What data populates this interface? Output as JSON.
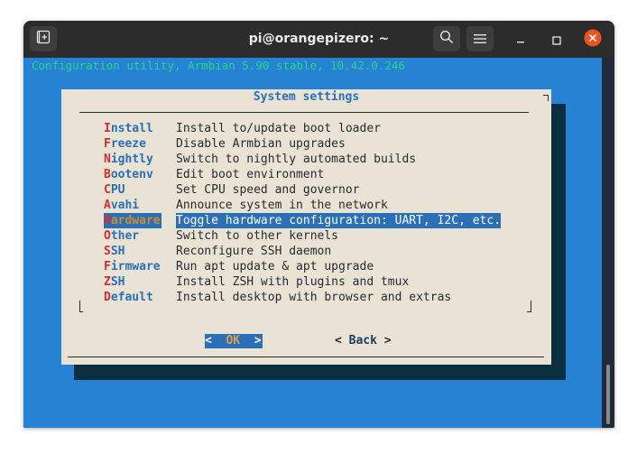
{
  "window": {
    "title": "pi@orangepizero: ~"
  },
  "terminal": {
    "backtitle": "Configuration utility, Armbian 5.90 stable, 10.42.0.246",
    "dialog": {
      "title": "System settings",
      "items": [
        {
          "hot": "I",
          "rest": "nstall",
          "desc": "Install to/update boot loader"
        },
        {
          "hot": "F",
          "rest": "reeze",
          "desc": "Disable Armbian upgrades"
        },
        {
          "hot": "N",
          "rest": "ightly",
          "desc": "Switch to nightly automated builds"
        },
        {
          "hot": "B",
          "rest": "ootenv",
          "desc": "Edit boot environment"
        },
        {
          "hot": "C",
          "rest": "PU",
          "desc": "Set CPU speed and governor"
        },
        {
          "hot": "A",
          "rest": "vahi",
          "desc": "Announce system in the network"
        },
        {
          "hot": "H",
          "rest": "ardware",
          "desc": "Toggle hardware configuration: UART, I2C, etc."
        },
        {
          "hot": "O",
          "rest": "ther",
          "desc": "Switch to other kernels"
        },
        {
          "hot": "S",
          "rest": "SH",
          "desc": "Reconfigure SSH daemon"
        },
        {
          "hot": "F",
          "rest": "irmware",
          "desc": "Run apt update & apt upgrade"
        },
        {
          "hot": "Z",
          "rest": "SH",
          "desc": "Install ZSH with plugins and tmux"
        },
        {
          "hot": "D",
          "rest": "efault",
          "desc": "Install desktop with browser and extras"
        }
      ],
      "selected_index": 6,
      "ok": {
        "left": "< ",
        "label": " OK ",
        "right": " >"
      },
      "back": {
        "left": "< ",
        "label": "Back",
        "right": " >"
      }
    }
  },
  "colors": {
    "screen_bg": "#2682d2",
    "dialog_bg": "#e8e3d4",
    "accent": "#2b6fb6",
    "hotkey": "#d62d2d",
    "close_button": "#e95420"
  },
  "icons": {
    "new_tab": "new-tab-icon",
    "search": "search-icon",
    "menu": "hamburger-menu-icon",
    "minimize": "minimize-icon",
    "maximize": "maximize-icon",
    "close": "close-icon"
  }
}
